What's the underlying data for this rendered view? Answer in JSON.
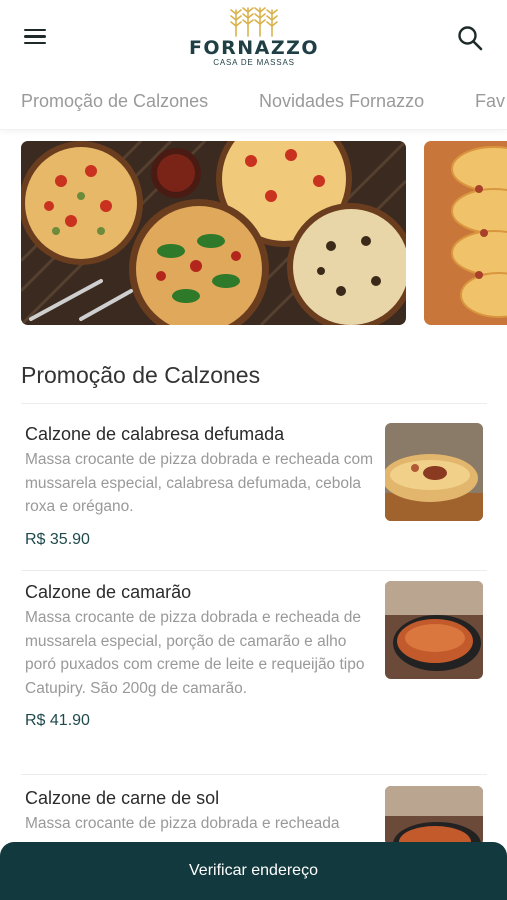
{
  "header": {
    "logo_name": "FORNAZZO",
    "logo_subtitle": "CASA DE MASSAS",
    "menu_icon": "hamburger-menu-icon",
    "search_icon": "search-icon"
  },
  "tabs": [
    {
      "label": "Promoção de Calzones"
    },
    {
      "label": "Novidades Fornazzo"
    },
    {
      "label": "Fav"
    }
  ],
  "section": {
    "title": "Promoção de Calzones"
  },
  "products": [
    {
      "name": "Calzone de calabresa defumada",
      "description": "Massa crocante de pizza dobrada e recheada com mussarela especial, calabresa defumada, cebola roxa e orégano.",
      "price": "R$ 35.90"
    },
    {
      "name": "Calzone de camarão",
      "description": "Massa crocante de pizza dobrada e recheada de mussarela especial, porção de camarão e alho poró puxados com creme de leite e requeijão tipo Catupiry. São 200g de camarão.",
      "price": "R$ 41.90"
    },
    {
      "name": "Calzone de carne de sol",
      "description": "Massa crocante de pizza dobrada e recheada"
    }
  ],
  "cta": {
    "label": "Verificar endereço"
  },
  "colors": {
    "brand_dark": "#12393d",
    "price": "#1f4a4c",
    "logo_gold": "#d9b24c"
  }
}
